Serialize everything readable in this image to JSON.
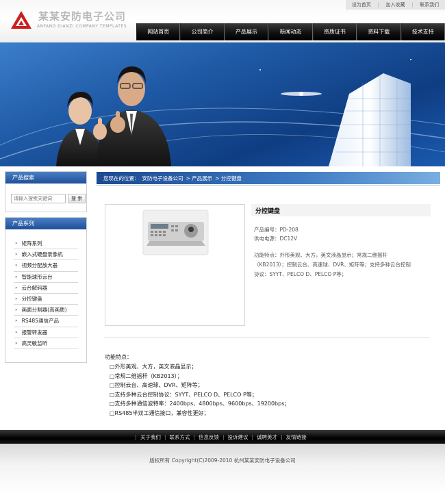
{
  "header": {
    "logo_cn": "某某安防电子公司",
    "logo_en": "ANFANG DIANZI COMPANY TEMPLATES",
    "toplinks": [
      "设为首页",
      "加入收藏",
      "联系我们"
    ],
    "nav": [
      "网站首页",
      "公司简介",
      "产品展示",
      "新闻动态",
      "资质证书",
      "资料下载",
      "技术支持"
    ]
  },
  "sidebar": {
    "search": {
      "title": "产品搜索",
      "placeholder": "请输入搜索关键词",
      "button": "搜 索"
    },
    "categories": {
      "title": "产品系列",
      "items": [
        "矩阵系列",
        "嵌入式硬盘录像机",
        "视频分配放大器",
        "智能球形云台",
        "云台解码器",
        "分控键盘",
        "画面分割器(高画质)",
        "RS485通信产品",
        "报警转发器",
        "高灵敏监听"
      ]
    }
  },
  "breadcrumb": {
    "prefix": "您现在的位置：",
    "items": [
      "安防电子设备公司",
      "> 产品展示",
      "> 分控键盘"
    ]
  },
  "product": {
    "title": "分控键盘",
    "code": "产品编号：PD-208",
    "power": "供电电源：DC12V",
    "features_line1": "功能特点：外形美观、大方，英文液晶显示；常规二维摇杆",
    "features_line2": "（KB2013）；控制云台、高速球、DVR、矩阵等；支持多种云台控制",
    "features_line3": "协议：SYYT、PELCO D、PELCO P等；"
  },
  "features": {
    "title": "功能特点：",
    "items": [
      "□外形美观、大方，英文液晶显示；",
      "□常规二维摇杆（KB2013）；",
      "□控制云台、高速球、DVR、矩阵等；",
      "□支持多种云台控制协议：SYYT、PELCO D、PELCO P等；",
      "□支持多种通信波特率：2400bps、4800bps、9600bps、19200bps；",
      "□RS485半双工通信接口，兼容性更好；"
    ]
  },
  "footer": {
    "links": [
      "关于我们",
      "联系方式",
      "信息反馈",
      "投诉建议",
      "诚聘英才",
      "友情链接"
    ],
    "copyright": "版权所有  Copyright(C)2009-2010 杭州某某安防电子设备公司"
  },
  "colors": {
    "nav_bg": "#000000",
    "accent_blue": "#1e4f98",
    "banner_blue": "#1f5aa6"
  }
}
